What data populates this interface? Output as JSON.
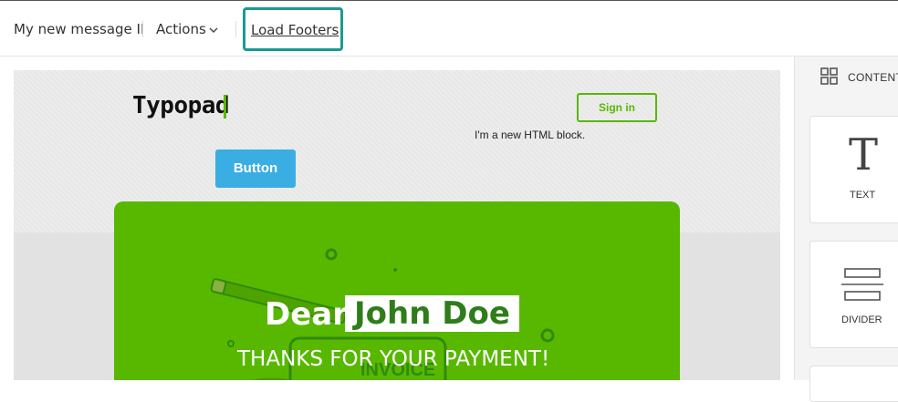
{
  "toolbar": {
    "message_title": "My new message II",
    "actions_label": "Actions",
    "load_footers_label": "Load Footers"
  },
  "email": {
    "logo_text": "Typopad",
    "sign_in_label": "Sign in",
    "html_block_text": "I'm a new HTML block.",
    "button_label": "Button",
    "greeting": "Dear",
    "recipient_name": "John Doe",
    "comma": ",",
    "thanks_message": "THANKS FOR YOUR PAYMENT!",
    "invoice_label": "INVOICE"
  },
  "content_panel": {
    "header_label": "CONTENT",
    "tiles": [
      {
        "label": "TEXT",
        "icon": "text-icon"
      },
      {
        "label": "DIVIDER",
        "icon": "divider-icon"
      }
    ]
  },
  "colors": {
    "brand_green": "#58b800",
    "button_blue": "#3aaee2",
    "highlight_teal": "#1a9a94",
    "name_green": "#2f7d1a"
  }
}
